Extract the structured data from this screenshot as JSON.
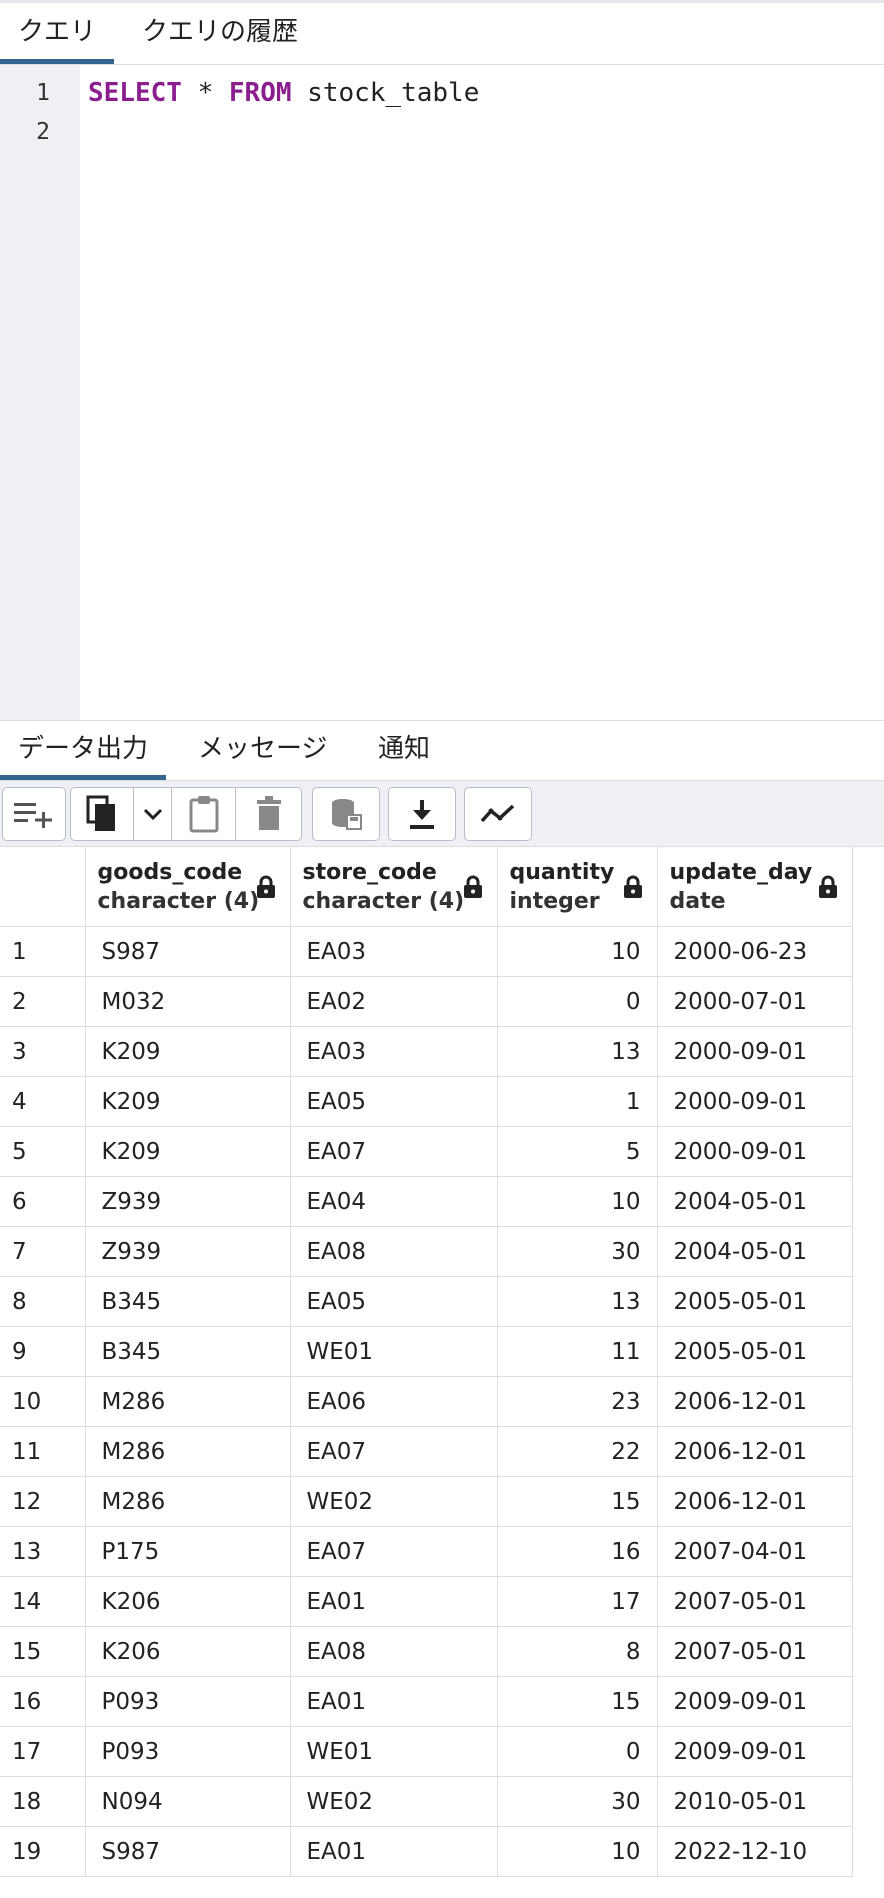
{
  "query_tabs": [
    {
      "label": "クエリ"
    },
    {
      "label": "クエリの履歴"
    }
  ],
  "editor": {
    "line_numbers": [
      "1",
      "2"
    ],
    "line1": {
      "kw1": "SELECT",
      "mid": " * ",
      "kw2": "FROM",
      "rest": " stock_table"
    }
  },
  "output_tabs": [
    {
      "label": "データ出力"
    },
    {
      "label": "メッセージ"
    },
    {
      "label": "通知"
    }
  ],
  "toolbar": {
    "buttons": [
      "add-row-icon",
      "copy-icon",
      "chevron-down-icon",
      "paste-icon",
      "delete-icon",
      "save-data-icon",
      "download-icon",
      "graph-icon"
    ]
  },
  "grid": {
    "columns": [
      {
        "name": "goods_code",
        "type": "character (4)"
      },
      {
        "name": "store_code",
        "type": "character (4)"
      },
      {
        "name": "quantity",
        "type": "integer"
      },
      {
        "name": "update_day",
        "type": "date"
      }
    ],
    "rows": [
      [
        "1",
        "S987",
        "EA03",
        "10",
        "2000-06-23"
      ],
      [
        "2",
        "M032",
        "EA02",
        "0",
        "2000-07-01"
      ],
      [
        "3",
        "K209",
        "EA03",
        "13",
        "2000-09-01"
      ],
      [
        "4",
        "K209",
        "EA05",
        "1",
        "2000-09-01"
      ],
      [
        "5",
        "K209",
        "EA07",
        "5",
        "2000-09-01"
      ],
      [
        "6",
        "Z939",
        "EA04",
        "10",
        "2004-05-01"
      ],
      [
        "7",
        "Z939",
        "EA08",
        "30",
        "2004-05-01"
      ],
      [
        "8",
        "B345",
        "EA05",
        "13",
        "2005-05-01"
      ],
      [
        "9",
        "B345",
        "WE01",
        "11",
        "2005-05-01"
      ],
      [
        "10",
        "M286",
        "EA06",
        "23",
        "2006-12-01"
      ],
      [
        "11",
        "M286",
        "EA07",
        "22",
        "2006-12-01"
      ],
      [
        "12",
        "M286",
        "WE02",
        "15",
        "2006-12-01"
      ],
      [
        "13",
        "P175",
        "EA07",
        "16",
        "2007-04-01"
      ],
      [
        "14",
        "K206",
        "EA01",
        "17",
        "2007-05-01"
      ],
      [
        "15",
        "K206",
        "EA08",
        "8",
        "2007-05-01"
      ],
      [
        "16",
        "P093",
        "EA01",
        "15",
        "2009-09-01"
      ],
      [
        "17",
        "P093",
        "WE01",
        "0",
        "2009-09-01"
      ],
      [
        "18",
        "N094",
        "WE02",
        "30",
        "2010-05-01"
      ],
      [
        "19",
        "S987",
        "EA01",
        "10",
        "2022-12-10"
      ]
    ]
  },
  "colors": {
    "accent": "#326690",
    "keyword": "#8b1e8f",
    "gutter": "#eef0f4"
  }
}
